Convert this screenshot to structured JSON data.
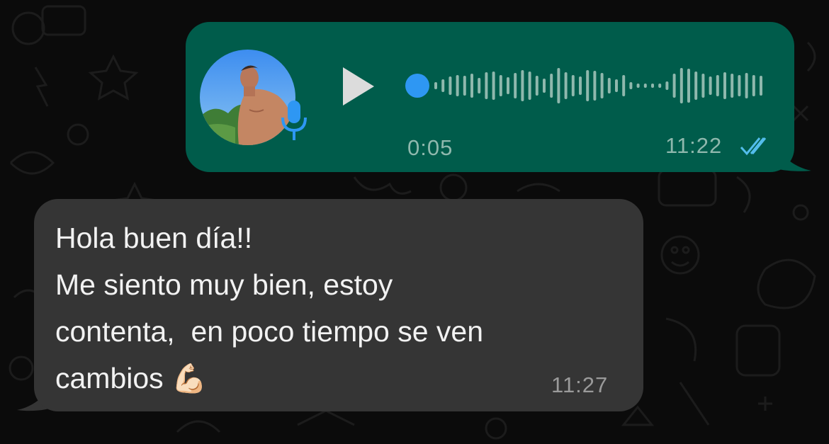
{
  "colors": {
    "background": "#0b0b0b",
    "outgoing_bubble": "#005c4b",
    "incoming_bubble": "#353535",
    "accent_blue": "#2e97f3",
    "read_ticks": "#53bdeb"
  },
  "voice_message": {
    "duration": "0:05",
    "time": "11:22",
    "status": "read",
    "progress": 0,
    "play_icon": "play-icon",
    "mic_icon": "microphone-icon",
    "ticks_icon": "double-check-icon"
  },
  "text_message": {
    "lines": [
      "Hola buen día!!",
      "Me siento muy bien, estoy",
      "contenta,  en poco tiempo se ven",
      "cambios "
    ],
    "emoji": "💪🏻",
    "time": "11:27"
  }
}
